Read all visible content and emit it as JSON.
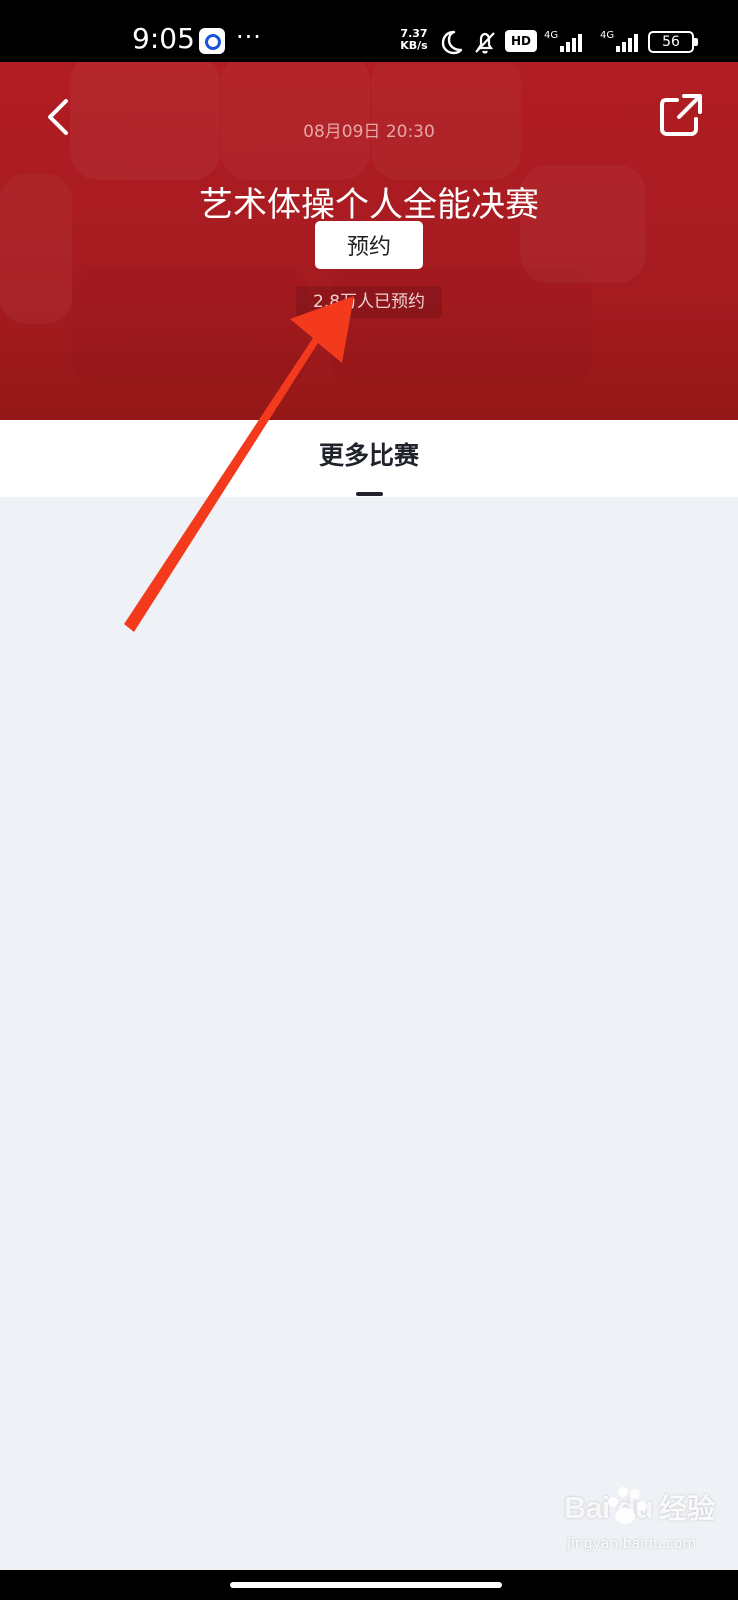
{
  "status_bar": {
    "time": "9:05",
    "more": "···",
    "network_speed": "7.37\nKB/s",
    "hd_label": "HD",
    "signal_1_label": "4G",
    "signal_2_label": "4G",
    "battery_percent": "56"
  },
  "header": {
    "event_time": "08月09日 20:30",
    "event_title": "艺术体操个人全能决赛",
    "reserve_button": "预约",
    "reserved_count": "2.8万人已预约"
  },
  "tabs": {
    "active": "更多比赛"
  },
  "watermark": {
    "brand": "Bai du",
    "service": "经验",
    "domain": "jingyan.baidu.com"
  },
  "icons": {
    "back": "back-arrow-icon",
    "share": "share-icon",
    "annotation": "red-pointer-arrow-icon"
  },
  "colors": {
    "header_red": "#b11d23",
    "arrow_red": "#f33a1d",
    "content_background": "#eef1f6",
    "text_dark": "#20232b"
  }
}
